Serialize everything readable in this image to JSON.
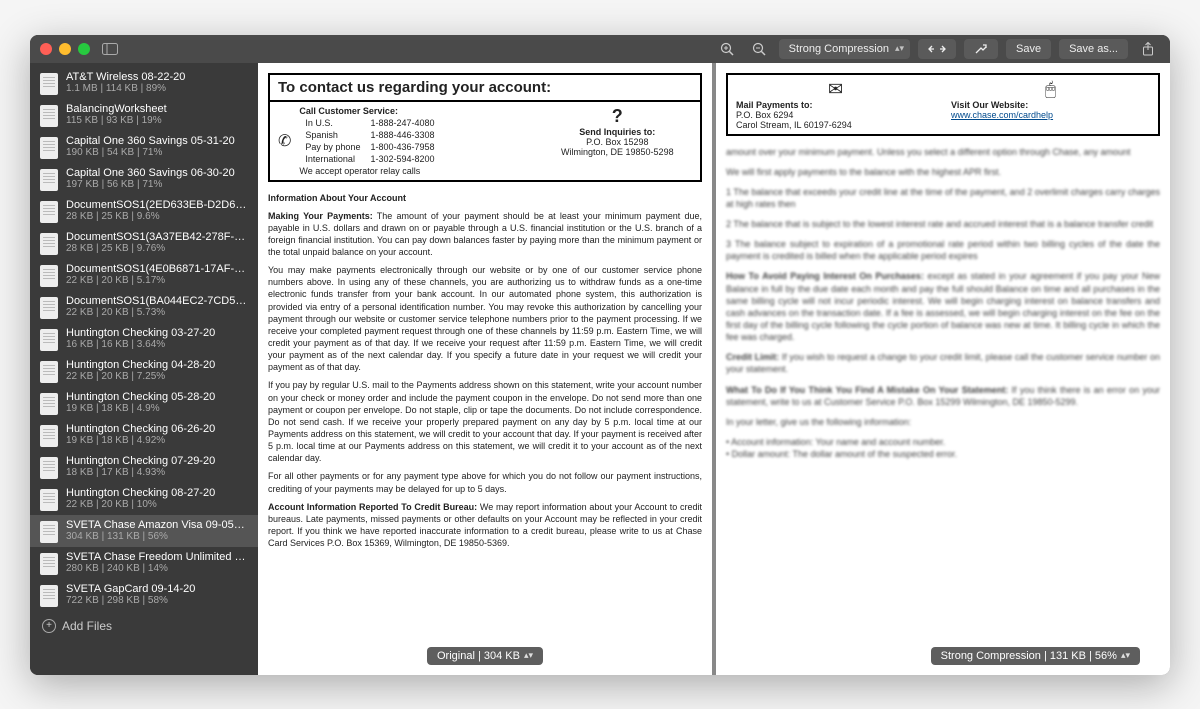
{
  "toolbar": {
    "compression_mode": "Strong Compression",
    "save": "Save",
    "save_as": "Save as..."
  },
  "sidebar": {
    "add_files": "Add Files",
    "items": [
      {
        "name": "AT&T Wireless 08-22-20",
        "meta": "1.1 MB | 114 KB | 89%"
      },
      {
        "name": "BalancingWorksheet",
        "meta": "115 KB | 93 KB | 19%"
      },
      {
        "name": "Capital One 360 Savings 05-31-20",
        "meta": "190 KB | 54 KB | 71%"
      },
      {
        "name": "Capital One 360 Savings 06-30-20",
        "meta": "197 KB | 56 KB | 71%"
      },
      {
        "name": "DocumentSOS1(2ED633EB-D2D6-4...",
        "meta": "28 KB | 25 KB | 9.6%"
      },
      {
        "name": "DocumentSOS1(3A37EB42-278F-47...",
        "meta": "28 KB | 25 KB | 9.76%"
      },
      {
        "name": "DocumentSOS1(4E0B6871-17AF-4B...",
        "meta": "22 KB | 20 KB | 5.17%"
      },
      {
        "name": "DocumentSOS1(BA044EC2-7CD5-4...",
        "meta": "22 KB | 20 KB | 5.73%"
      },
      {
        "name": "Huntington Checking 03-27-20",
        "meta": "16 KB | 16 KB | 3.64%"
      },
      {
        "name": "Huntington Checking 04-28-20",
        "meta": "22 KB | 20 KB | 7.25%"
      },
      {
        "name": "Huntington Checking 05-28-20",
        "meta": "19 KB | 18 KB | 4.9%"
      },
      {
        "name": "Huntington Checking 06-26-20",
        "meta": "19 KB | 18 KB | 4.92%"
      },
      {
        "name": "Huntington Checking 07-29-20",
        "meta": "18 KB | 17 KB | 4.93%"
      },
      {
        "name": "Huntington Checking 08-27-20",
        "meta": "22 KB | 20 KB | 10%"
      },
      {
        "name": "SVETA Chase Amazon Visa 09-05-20",
        "meta": "304 KB | 131 KB | 56%",
        "selected": true
      },
      {
        "name": "SVETA Chase Freedom Unlimited 09-...",
        "meta": "280 KB | 240 KB | 14%"
      },
      {
        "name": "SVETA GapCard 09-14-20",
        "meta": "722 KB | 298 KB | 58%"
      }
    ]
  },
  "document": {
    "contact_title": "To contact us regarding your account:",
    "call_service": "Call Customer Service:",
    "in_us": "In U.S.",
    "in_us_num": "1-888-247-4080",
    "spanish": "Spanish",
    "spanish_num": "1-888-446-3308",
    "pay_by_phone": "Pay by phone",
    "pay_num": "1-800-436-7958",
    "international": "International",
    "intl_num": "1-302-594-8200",
    "relay": "We accept operator relay calls",
    "inquiries_title": "Send Inquiries to:",
    "inquiries_line1": "P.O. Box 15298",
    "inquiries_line2": "Wilmington, DE 19850-5298",
    "mail_title": "Mail Payments to:",
    "mail_line1": "P.O. Box 6294",
    "mail_line2": "Carol Stream, IL 60197-6294",
    "website_title": "Visit Our Website:",
    "website_url": "www.chase.com/cardhelp",
    "info_heading": "Information About Your Account",
    "p1_bold": "Making Your Payments:",
    "p1": " The amount of your payment should be at least your minimum payment due, payable in U.S. dollars and drawn on or payable through a U.S. financial institution or the U.S. branch of a foreign financial institution. You can pay down balances faster by paying more than the minimum payment or the total unpaid balance on your account.",
    "p2": "You may make payments electronically through our website or by one of our customer service phone numbers above. In using any of these channels, you are authorizing us to withdraw funds as a one-time electronic funds transfer from your bank account. In our automated phone system, this authorization is provided via entry of a personal identification number. You may revoke this authorization by cancelling your payment through our website or customer service telephone numbers prior to the payment processing. If we receive your completed payment request through one of these channels by 11:59 p.m. Eastern Time, we will credit your payment as of that day. If we receive your request after 11:59 p.m. Eastern Time, we will credit your payment as of the next calendar day. If you specify a future date in your request we will credit your payment as of that day.",
    "p3": "If you pay by regular U.S. mail to the Payments address shown on this statement, write your account number on your check or money order and include the payment coupon in the envelope. Do not send more than one payment or coupon per envelope. Do not staple, clip or tape the documents. Do not include correspondence. Do not send cash. If we receive your properly prepared payment on any day by 5 p.m. local time at our Payments address on this statement, we will credit to your account that day. If your payment is received after 5 p.m. local time at our Payments address on this statement, we will credit it to your account as of the next calendar day.",
    "p4": "For all other payments or for any payment type above for which you do not follow our payment instructions, crediting of your payments may be delayed for up to 5 days.",
    "p5_bold": "Account Information Reported To Credit Bureau:",
    "p5": " We may report information about your Account to credit bureaus. Late payments, missed payments or other defaults on your Account may be reflected in your credit report. If you think we have reported inaccurate information to a credit bureau, please write to us at Chase Card Services P.O. Box 15369, Wilmington, DE 19850-5369."
  },
  "badges": {
    "original": "Original | 304 KB",
    "compressed": "Strong Compression | 131 KB | 56%"
  }
}
